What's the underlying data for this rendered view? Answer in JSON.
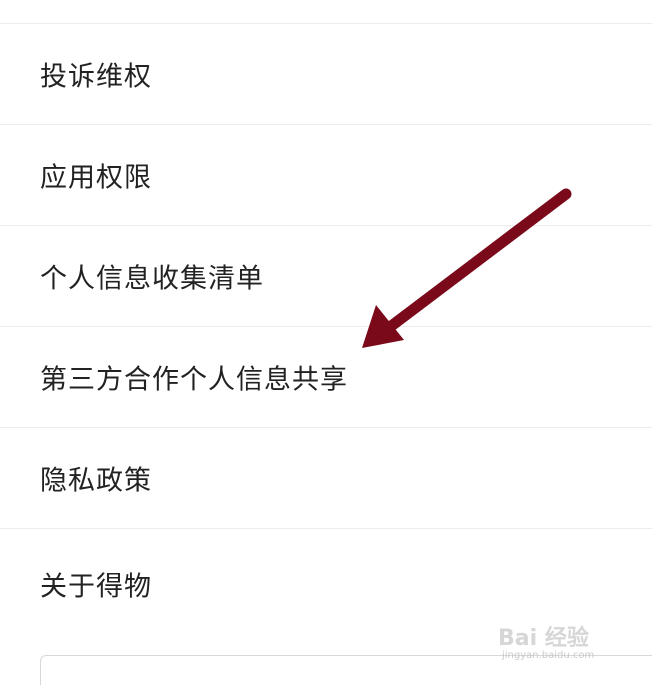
{
  "menu": {
    "items": [
      {
        "label": "投诉维权"
      },
      {
        "label": "应用权限"
      },
      {
        "label": "个人信息收集清单"
      },
      {
        "label": "第三方合作个人信息共享"
      },
      {
        "label": "隐私政策"
      },
      {
        "label": "关于得物"
      }
    ]
  },
  "annotation": {
    "arrow_color": "#7a0a1a",
    "arrow_icon": "arrow-pointer-icon"
  },
  "watermark": {
    "brand": "Bai 经验",
    "url": "jingyan.baidu.com"
  }
}
